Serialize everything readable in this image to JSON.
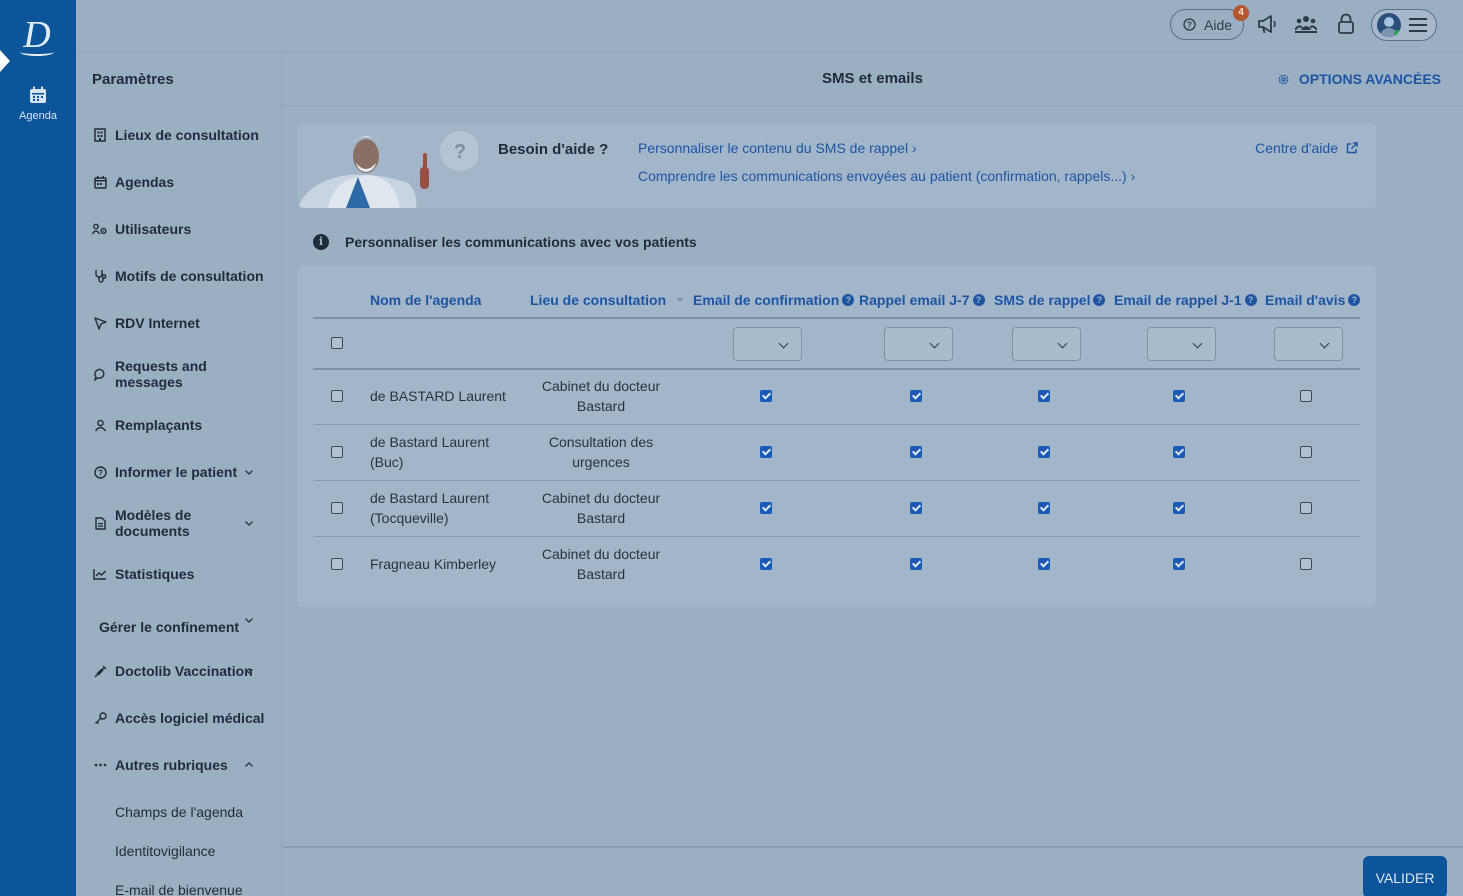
{
  "rail": {
    "logo": "D",
    "nav_label": "Agenda",
    "active_marker": "arrow-right"
  },
  "topbar": {
    "help_label": "Aide",
    "notif_count": "4",
    "icons": [
      "help-circle-icon",
      "megaphone-icon",
      "team-icon",
      "lock-icon",
      "avatar",
      "menu-icon"
    ]
  },
  "sidebar": {
    "title": "Paramètres",
    "items": [
      {
        "label": "Lieux de consultation",
        "icon": "building-icon"
      },
      {
        "label": "Agendas",
        "icon": "calendar-icon"
      },
      {
        "label": "Utilisateurs",
        "icon": "users-gear-icon"
      },
      {
        "label": "Motifs de consultation",
        "icon": "stethoscope-icon"
      },
      {
        "label": "RDV Internet",
        "icon": "cursor-icon"
      },
      {
        "label": "Requests and messages",
        "icon": "chat-icon"
      },
      {
        "label": "Remplaçants",
        "icon": "user-swap-icon"
      },
      {
        "label": "Informer le patient",
        "icon": "help-circle-icon",
        "expandable": true
      },
      {
        "label": "Modèles de documents",
        "icon": "document-icon",
        "expandable": true
      },
      {
        "label": "Statistiques",
        "icon": "chart-icon"
      },
      {
        "label": "Gérer le confinement",
        "expandable": true
      },
      {
        "label": "Doctolib Vaccination",
        "icon": "syringe-icon",
        "expandable": true
      },
      {
        "label": "Accès logiciel médical",
        "icon": "key-icon"
      },
      {
        "label": "Autres rubriques",
        "icon": "ellipsis-icon",
        "expanded": true
      }
    ],
    "subitems": [
      "Champs de l'agenda",
      "Identitovigilance",
      "E-mail de bienvenue"
    ]
  },
  "header": {
    "title": "SMS et emails",
    "advanced_label": "OPTIONS AVANCÉES"
  },
  "help": {
    "need_label": "Besoin d'aide ?",
    "link1": "Personnaliser le contenu du SMS de rappel ›",
    "link2": "Comprendre les communications envoyées au patient (confirmation, rappels...) ›",
    "center_label": "Centre d'aide"
  },
  "info": {
    "text": "Personnaliser les communications avec vos patients"
  },
  "table": {
    "headers": [
      "Nom de l'agenda",
      "Lieu de consultation",
      "Email de confirmation",
      "Rappel email J-7",
      "SMS de rappel",
      "Email de rappel J-1",
      "Email d'avis"
    ],
    "rows": [
      {
        "name_l1": "de BASTARD Laurent",
        "name_l2": "",
        "place_l1": "Cabinet du docteur",
        "place_l2": "Bastard",
        "checks": [
          true,
          true,
          true,
          true,
          false
        ]
      },
      {
        "name_l1": "de Bastard Laurent",
        "name_l2": "(Buc)",
        "place_l1": "Consultation des",
        "place_l2": "urgences",
        "checks": [
          true,
          true,
          true,
          true,
          false
        ]
      },
      {
        "name_l1": "de Bastard Laurent",
        "name_l2": "(Tocqueville)",
        "place_l1": "Cabinet du docteur",
        "place_l2": "Bastard",
        "checks": [
          true,
          true,
          true,
          true,
          false
        ]
      },
      {
        "name_l1": "Fragneau Kimberley",
        "name_l2": "",
        "place_l1": "Cabinet du docteur",
        "place_l2": "Bastard",
        "checks": [
          true,
          true,
          true,
          true,
          false
        ]
      }
    ]
  },
  "footer": {
    "submit_label": "VALIDER"
  },
  "colors": {
    "rail": "#0c559a",
    "link": "#1d55a3",
    "checked": "#1b5bb7",
    "notif": "#b4572f"
  }
}
